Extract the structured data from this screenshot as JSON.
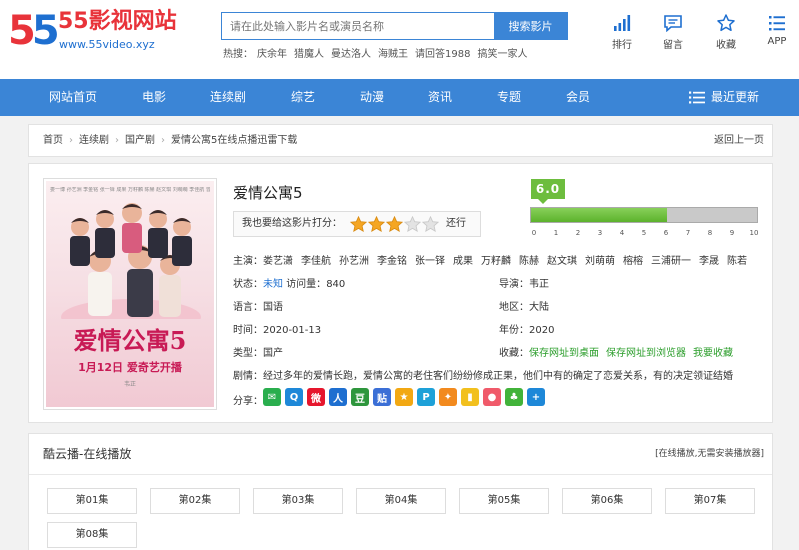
{
  "site": {
    "logo_mark": "55",
    "title": "55影视网站",
    "url": "www.55video.xyz"
  },
  "search": {
    "placeholder": "请在此处输入影片名或演员名称",
    "button": "搜索影片",
    "hot_label": "热搜：",
    "hot": [
      "庆余年",
      "猎魔人",
      "曼达洛人",
      "海贼王",
      "请回答1988",
      "搞笑一家人"
    ]
  },
  "tools": [
    {
      "label": "排行",
      "icon": "ranking-icon"
    },
    {
      "label": "留言",
      "icon": "message-icon"
    },
    {
      "label": "收藏",
      "icon": "star-icon"
    },
    {
      "label": "APP",
      "icon": "menu-icon"
    }
  ],
  "nav": {
    "items": [
      "网站首页",
      "电影",
      "连续剧",
      "综艺",
      "动漫",
      "资讯",
      "专题",
      "会员"
    ],
    "latest": "最近更新"
  },
  "breadcrumb": {
    "items": [
      "首页",
      "连续剧",
      "国产剧",
      "爱情公寓5在线点播迅雷下载"
    ],
    "back": "返回上一页"
  },
  "movie": {
    "title": "爱情公寓5",
    "rate_label": "我也要给这影片打分：",
    "rate_word": "还行",
    "stars_filled": 3,
    "stars_total": 5,
    "score": "6.0",
    "score_value": 6.0,
    "score_max": 10,
    "score_ticks": [
      "0",
      "1",
      "2",
      "3",
      "4",
      "5",
      "6",
      "7",
      "8",
      "9",
      "10"
    ],
    "cast_label": "主演：",
    "cast": [
      "娄艺潇",
      "李佳航",
      "孙艺洲",
      "李金铭",
      "张一铎",
      "成果",
      "万籽麟",
      "陈赫",
      "赵文琪",
      "刘萌萌",
      "榕榕",
      "三浦研一",
      "李晟",
      "陈若"
    ],
    "status_label": "状态：",
    "status_value": "未知",
    "views_label": "访问量：",
    "views_value": "840",
    "director_label": "导演：",
    "director_value": "韦正",
    "lang_label": "语言：",
    "lang_value": "国语",
    "region_label": "地区：",
    "region_value": "大陆",
    "time_label": "时间：",
    "time_value": "2020-01-13",
    "year_label": "年份：",
    "year_value": "2020",
    "type_label": "类型：",
    "type_value": "国产",
    "fav_label": "收藏：",
    "fav_links": [
      "保存网址到桌面",
      "保存网址到浏览器",
      "我要收藏"
    ],
    "plot_label": "剧情：",
    "plot": "经过多年的爱情长跑，爱情公寓的老住客们纷纷修成正果，他们中有的确定了恋爱关系，有的决定领证结婚",
    "share_label": "分享："
  },
  "poster": {
    "title": "爱情公寓5",
    "date": "1月12日  爱奇艺开播",
    "director": "韦正",
    "names": "娄一博 孙艺洲 李金铭 张一铎 成果 万籽麟 陈赫 赵文琪 刘萌萌 李佳航 曾小贤"
  },
  "share_icons": [
    {
      "name": "wechat-icon",
      "color": "#2aae4e",
      "glyph": "✉"
    },
    {
      "name": "qq-icon",
      "color": "#1e88d8",
      "glyph": "Q"
    },
    {
      "name": "weibo-icon",
      "color": "#e6162d",
      "glyph": "微"
    },
    {
      "name": "renren-icon",
      "color": "#1e6fd0",
      "glyph": "人"
    },
    {
      "name": "douban-icon",
      "color": "#2e963d",
      "glyph": "豆"
    },
    {
      "name": "tieba-icon",
      "color": "#3b6fd6",
      "glyph": "贴"
    },
    {
      "name": "qzone-icon",
      "color": "#f2a813",
      "glyph": "★"
    },
    {
      "name": "pocket-icon",
      "color": "#1ea1d8",
      "glyph": "P"
    },
    {
      "name": "kaixin-icon",
      "color": "#f28a1e",
      "glyph": "✦"
    },
    {
      "name": "bookmark-icon",
      "color": "#f2c01e",
      "glyph": "▮"
    },
    {
      "name": "tuita-icon",
      "color": "#f05a6a",
      "glyph": "●"
    },
    {
      "name": "clover-icon",
      "color": "#42b33a",
      "glyph": "♣"
    },
    {
      "name": "more-icon",
      "color": "#1e88d8",
      "glyph": "+"
    }
  ],
  "player": {
    "title": "酷云播-在线播放",
    "note": "[在线播放,无需安装播放器]",
    "episodes": [
      "第01集",
      "第02集",
      "第03集",
      "第04集",
      "第05集",
      "第06集",
      "第07集",
      "第08集"
    ]
  },
  "colors": {
    "brand_blue": "#3b85d6",
    "brand_red": "#e8333a",
    "score_green": "#6dbd3e",
    "star_gold": "#f5a623"
  }
}
